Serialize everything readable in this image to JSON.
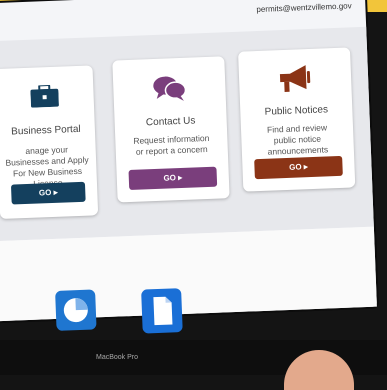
{
  "header": {
    "email": "permits@wentzvillemo.gov"
  },
  "cards": [
    {
      "title": "Business Portal",
      "description": "anage your Businesses and Apply For New Business License",
      "button": "GO ▸",
      "color": "#14405e",
      "icon": "briefcase-icon"
    },
    {
      "title": "Contact Us",
      "description": "Request information or report a concern",
      "button": "GO ▸",
      "color": "#7a3e7c",
      "icon": "chat-bubbles-icon"
    },
    {
      "title": "Public Notices",
      "description": "Find and review public notice announcements",
      "button": "GO ▸",
      "color": "#8b3416",
      "icon": "megaphone-icon"
    }
  ],
  "dock": [
    {
      "icon": "keynote-chart-icon"
    },
    {
      "icon": "pages-document-icon"
    }
  ],
  "laptop": {
    "label": "MacBook Pro"
  }
}
